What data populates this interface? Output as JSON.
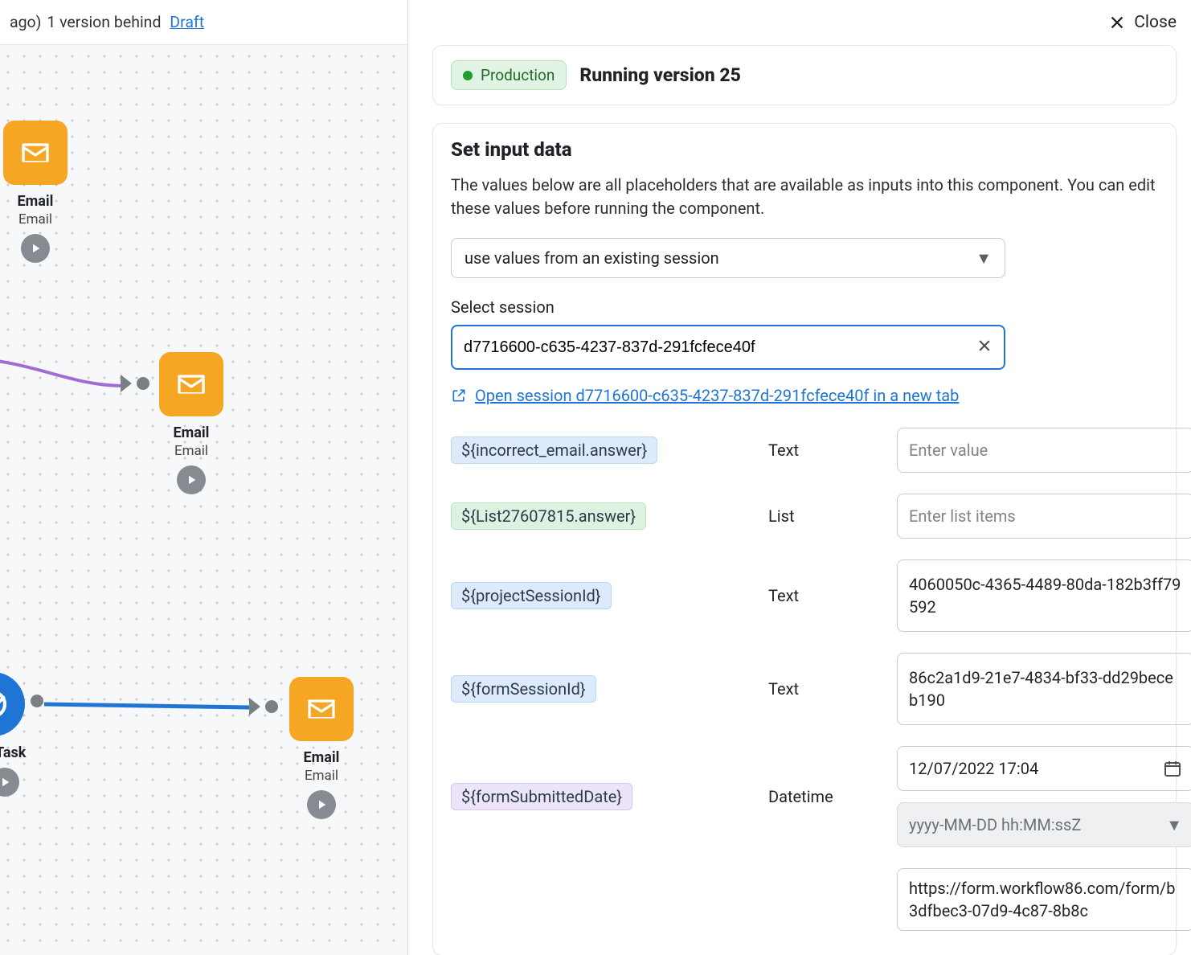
{
  "canvas": {
    "header_prefix_fragment": "ago)",
    "version_text": "1 version behind",
    "draft_link": "Draft",
    "nodes": [
      {
        "id": "email1",
        "title": "Email",
        "subtitle": "Email"
      },
      {
        "id": "email2",
        "title": "Email",
        "subtitle": "Email"
      },
      {
        "id": "task",
        "title": "n Task",
        "subtitle": ""
      },
      {
        "id": "email3",
        "title": "Email",
        "subtitle": "Email"
      }
    ]
  },
  "top": {
    "close_label": "Close"
  },
  "status": {
    "pill_label": "Production",
    "running_label": "Running version 25"
  },
  "input": {
    "section_title": "Set input data",
    "description": "The values below are all placeholders that are available as inputs into this component. You can edit these values before running the component.",
    "source_select_label": "use values from an existing session",
    "session_label": "Select session",
    "session_value": "d7716600-c635-4237-837d-291fcfece40f",
    "open_session_text": "Open session d7716600-c635-4237-837d-291fcfece40f in a new tab",
    "placeholders": {
      "text_placeholder": "Enter value",
      "list_placeholder": "Enter list items"
    },
    "date_format_label": "yyyy-MM-DD hh:MM:ssZ",
    "rows": [
      {
        "chip": "${incorrect_email.answer}",
        "chip_color": "blue",
        "type": "Text",
        "value": ""
      },
      {
        "chip": "${List27607815.answer}",
        "chip_color": "green",
        "type": "List",
        "value": ""
      },
      {
        "chip": "${projectSessionId}",
        "chip_color": "blue",
        "type": "Text",
        "value": "4060050c-4365-4489-80da-182b3ff79592"
      },
      {
        "chip": "${formSessionId}",
        "chip_color": "blue",
        "type": "Text",
        "value": "86c2a1d9-21e7-4834-bf33-dd29beceb190"
      },
      {
        "chip": "${formSubmittedDate}",
        "chip_color": "purple",
        "type": "Datetime",
        "value": "12/07/2022 17:04"
      },
      {
        "chip": "",
        "chip_color": "",
        "type": "",
        "value": "https://form.workflow86.com/form/b3dfbec3-07d9-4c87-8b8c"
      }
    ]
  },
  "colors": {
    "accent": "#1f75d5",
    "orange": "#f5a623",
    "green_pill_bg": "#e1f3e3",
    "green_dot": "#1f9d2f"
  }
}
